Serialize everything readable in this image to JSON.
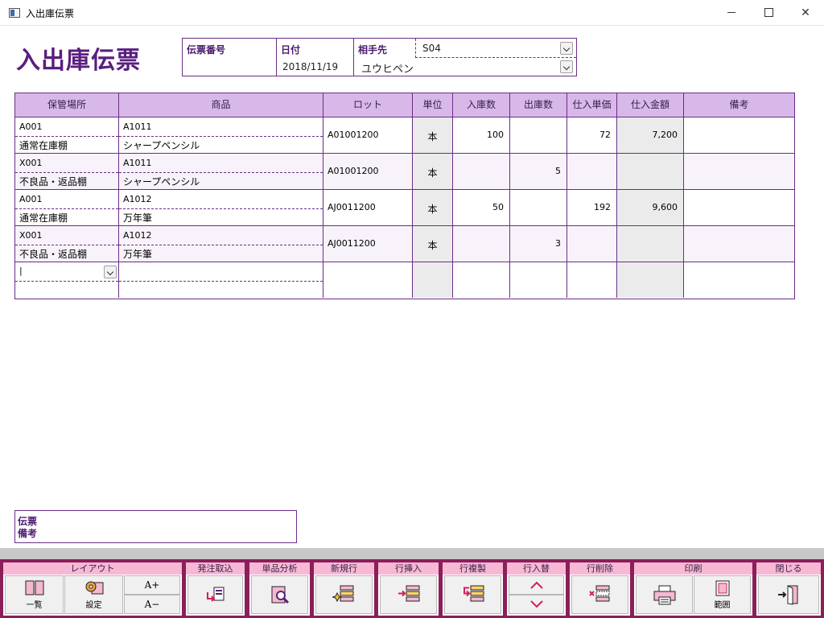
{
  "window": {
    "title": "入出庫伝票"
  },
  "page": {
    "title": "入出庫伝票"
  },
  "header": {
    "slip_no_label": "伝票番号",
    "slip_no_value": "",
    "date_label": "日付",
    "date_value": "2018/11/19",
    "partner_label": "相手先",
    "partner_code": "S04",
    "partner_name": "ユウヒペン"
  },
  "grid": {
    "columns": [
      "保管場所",
      "商品",
      "ロット",
      "単位",
      "入庫数",
      "出庫数",
      "仕入単価",
      "仕入金額",
      "備考"
    ],
    "rows": [
      {
        "loc_code": "A001",
        "loc_name": "通常在庫棚",
        "item_code": "A1011",
        "item_name": "シャープペンシル",
        "lot": "A01001200",
        "unit": "本",
        "in_qty": "100",
        "out_qty": "",
        "unit_price": "72",
        "amount": "7,200",
        "note": ""
      },
      {
        "loc_code": "X001",
        "loc_name": "不良品・返品棚",
        "item_code": "A1011",
        "item_name": "シャープペンシル",
        "lot": "A01001200",
        "unit": "本",
        "in_qty": "",
        "out_qty": "5",
        "unit_price": "",
        "amount": "",
        "note": ""
      },
      {
        "loc_code": "A001",
        "loc_name": "通常在庫棚",
        "item_code": "A1012",
        "item_name": "万年筆",
        "lot": "AJ0011200",
        "unit": "本",
        "in_qty": "50",
        "out_qty": "",
        "unit_price": "192",
        "amount": "9,600",
        "note": ""
      },
      {
        "loc_code": "X001",
        "loc_name": "不良品・返品棚",
        "item_code": "A1012",
        "item_name": "万年筆",
        "lot": "AJ0011200",
        "unit": "本",
        "in_qty": "",
        "out_qty": "3",
        "unit_price": "",
        "amount": "",
        "note": ""
      }
    ],
    "new_row_cursor": "|"
  },
  "remark": {
    "label_line1": "伝票",
    "label_line2": "備考"
  },
  "toolbar": {
    "layout": {
      "group": "レイアウト",
      "list": "一覧",
      "settings": "設定",
      "font_up": "A+",
      "font_down": "A−"
    },
    "order_import": "発注取込",
    "item_analysis": "単品分析",
    "new_row": "新規行",
    "insert_row": "行挿入",
    "copy_row": "行複製",
    "swap_row": "行入替",
    "delete_row": "行削除",
    "print": {
      "group": "印刷",
      "range": "範囲"
    },
    "close": "閉じる"
  },
  "colors": {
    "accent": "#5a1e80",
    "border": "#6a2d87",
    "header_bg": "#d8b8e8",
    "toolbar_bg": "#8a1f5a",
    "group_label_bg": "#f6b8d4"
  }
}
